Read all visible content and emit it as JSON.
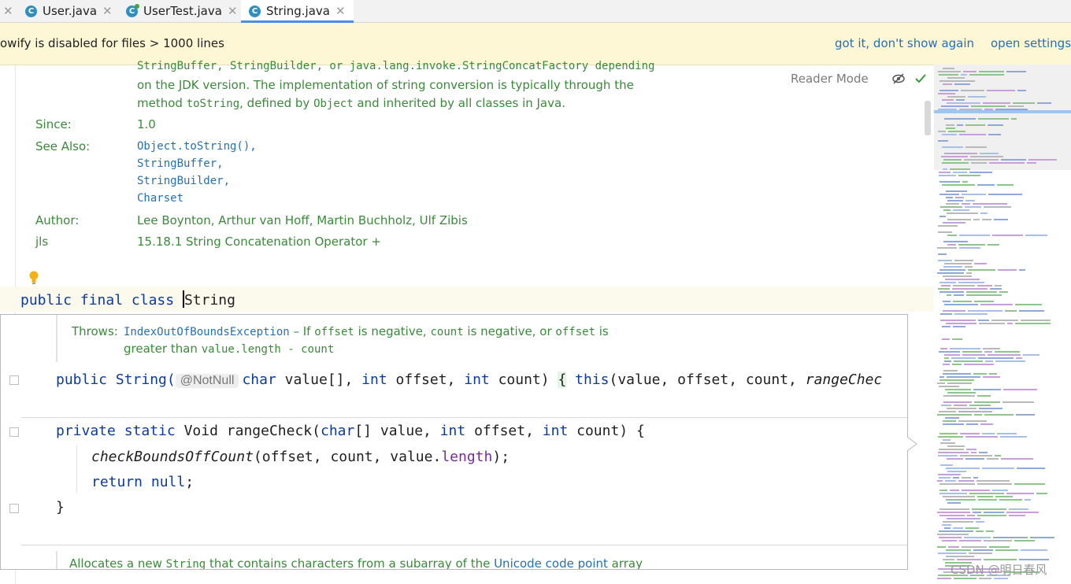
{
  "tabs": [
    {
      "label": "User.java",
      "icon": "class-icon"
    },
    {
      "label": "UserTest.java",
      "icon": "test-class-icon"
    },
    {
      "label": "String.java",
      "icon": "class-icon",
      "active": true
    }
  ],
  "banner": {
    "message": "owify is disabled for files > 1000 lines",
    "dismiss": "got it, don't show again",
    "settings": "open settings"
  },
  "reader_mode": "Reader Mode",
  "doc": {
    "line0": "StringBuffer, StringBuilder, or java.lang.invoke.StringConcatFactory depending",
    "line1_pre": "on the JDK version. The implementation of string conversion is typically through the",
    "line2_a": "method ",
    "line2_b": "toString",
    "line2_c": ", defined by ",
    "line2_d": "Object",
    "line2_e": " and inherited by all classes in Java.",
    "since_label": "Since:",
    "since_value": "1.0",
    "see_also_label": "See Also:",
    "see_also": [
      "Object.toString(),",
      "StringBuffer,",
      "StringBuilder,",
      "Charset"
    ],
    "author_label": "Author:",
    "author_value": "Lee Boynton, Arthur van Hoff, Martin Buchholz, Ulf Zibis",
    "jls_label": "jls",
    "jls_value": "15.18.1 String Concatenation Operator +"
  },
  "class_decl": {
    "kw1": "public",
    "kw2": "final",
    "kw3": "class",
    "name": "String"
  },
  "popup": {
    "throws_label": "Throws:",
    "throws_exc": "IndexOutOfBoundsException",
    "throws_t1": " – If ",
    "throws_c1": "offset",
    "throws_t2": " is negative, ",
    "throws_c2": "count",
    "throws_t3": " is negative, or ",
    "throws_c3": "offset",
    "throws_t4": " is",
    "throws_line2_a": "greater than ",
    "throws_line2_b": "value.length - count",
    "ctor": {
      "kw": "public",
      "type": "String(",
      "annotation": "@NotNull",
      "p1": "char",
      "p1b": " value[], ",
      "p2": "int",
      "p2b": " offset, ",
      "p3": "int",
      "p3b": " count) ",
      "brace": "{",
      "this": " this",
      "rest": "(value, offset, count, ",
      "call": "rangeChec"
    },
    "method": {
      "kw1": "private",
      "kw2": "static",
      "ret": " Void ",
      "name": "rangeCheck(",
      "p1": "char",
      "p1b": "[] value, ",
      "p2": "int",
      "p2b": " offset, ",
      "p3": "int",
      "p3b": " count) {",
      "body1_call": "checkBoundsOffCount",
      "body1_args": "(offset, count, value.",
      "body1_field": "length",
      "body1_end": ");",
      "body2_kw": "return",
      "body2_kw2": " null",
      "body2_end": ";",
      "close": "}"
    },
    "bottom_a": "Allocates a new ",
    "bottom_code": "String",
    "bottom_b": " that contains characters from a subarray of the ",
    "bottom_link": "Unicode code point",
    "bottom_c": " array"
  },
  "watermark": "CSDN @明日春风",
  "colors": {
    "keyword": "#0b3b9e",
    "doc_text": "#3a8a3a",
    "doc_link": "#2470b3",
    "banner_bg": "#fdf7d5",
    "field": "#7a2b9a"
  }
}
